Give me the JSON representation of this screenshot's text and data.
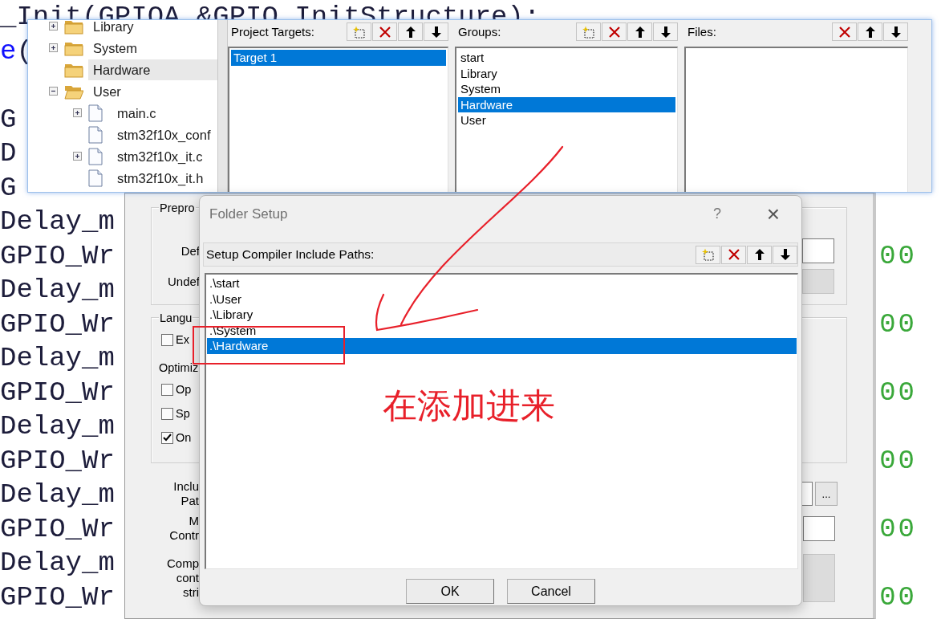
{
  "code_editor": {
    "lines": [
      {
        "kind": "code",
        "text": "_Init(GPIOA,&GPIO_InitStructure);"
      },
      {
        "kind": "call",
        "keyword": "e",
        "text": "("
      },
      {
        "kind": "blank"
      },
      {
        "kind": "code",
        "text": "G"
      },
      {
        "kind": "code",
        "text": "D"
      },
      {
        "kind": "code",
        "text": "G"
      },
      {
        "kind": "code",
        "text": "Delay_m"
      },
      {
        "kind": "code",
        "text": "GPIO_Wr",
        "value": "00"
      },
      {
        "kind": "code",
        "text": "Delay_m"
      },
      {
        "kind": "code",
        "text": "GPIO_Wr",
        "value": "00"
      },
      {
        "kind": "code",
        "text": "Delay_m"
      },
      {
        "kind": "code",
        "text": "GPIO_Wr",
        "value": "00"
      },
      {
        "kind": "code",
        "text": "Delay_m"
      },
      {
        "kind": "code",
        "text": "GPIO_Wr",
        "value": "00"
      },
      {
        "kind": "code",
        "text": "Delay_m"
      },
      {
        "kind": "code",
        "text": "GPIO_Wr",
        "value": "00"
      },
      {
        "kind": "code",
        "text": "Delay_m"
      },
      {
        "kind": "code",
        "text": "GPIO_Wr",
        "value": "00"
      }
    ]
  },
  "options_dialog": {
    "preprocessor_group": {
      "legend": "Prepro",
      "rows": [
        {
          "label": "Def",
          "disabled": false
        },
        {
          "label": "Undef",
          "disabled": true
        }
      ]
    },
    "language_group": {
      "legend": "Langu",
      "checkbox": {
        "label": "Ex",
        "checked": false
      },
      "optimize_label": "Optimiz",
      "checkboxes": [
        {
          "label": "Op",
          "checked": false
        },
        {
          "label": "Sp",
          "checked": false
        },
        {
          "label": "On",
          "checked": true
        }
      ]
    },
    "bottom_rows": [
      {
        "label_lines": [
          "Inclu",
          "Pat"
        ],
        "disabled": false,
        "browse_button": "..."
      },
      {
        "label_lines": [
          "M",
          "Contr"
        ],
        "disabled": false
      },
      {
        "label_lines": [
          "Comp",
          "cont",
          "stri"
        ],
        "disabled": true
      }
    ]
  },
  "project_window": {
    "tree": [
      {
        "kind": "folder",
        "label": "Library",
        "expanded": false,
        "selected": false
      },
      {
        "kind": "folder",
        "label": "System",
        "expanded": false,
        "selected": false
      },
      {
        "kind": "folder",
        "label": "Hardware",
        "selected": true
      },
      {
        "kind": "folder",
        "label": "User",
        "expanded": true,
        "selected": false,
        "children": [
          {
            "kind": "file",
            "label": "main.c",
            "expanded": false,
            "selected": false
          },
          {
            "kind": "file",
            "label": "stm32f10x_conf",
            "selected": false
          },
          {
            "kind": "file",
            "label": "stm32f10x_it.c",
            "expanded": false,
            "selected": false
          },
          {
            "kind": "file",
            "label": "stm32f10x_it.h",
            "selected": false
          }
        ]
      }
    ],
    "panels": [
      {
        "label": "Project Targets:",
        "tools": [
          {
            "kind": "new"
          },
          {
            "kind": "delete"
          },
          {
            "kind": "up"
          },
          {
            "kind": "down"
          }
        ],
        "items": [
          {
            "text": "Target 1",
            "selected": true
          }
        ]
      },
      {
        "label": "Groups:",
        "tools": [
          {
            "kind": "new"
          },
          {
            "kind": "delete"
          },
          {
            "kind": "up"
          },
          {
            "kind": "down"
          }
        ],
        "items": [
          {
            "text": "start",
            "selected": false
          },
          {
            "text": "Library",
            "selected": false
          },
          {
            "text": "System",
            "selected": false
          },
          {
            "text": "Hardware",
            "selected": true
          },
          {
            "text": "User",
            "selected": false
          }
        ]
      },
      {
        "label": "Files:",
        "tools": [
          {
            "kind": "delete"
          },
          {
            "kind": "up"
          },
          {
            "kind": "down"
          }
        ]
      }
    ]
  },
  "folder_setup": {
    "title": "Folder Setup",
    "help": "?",
    "close": "×",
    "list_label": "Setup Compiler Include Paths:",
    "tools": [
      {
        "kind": "new"
      },
      {
        "kind": "delete"
      },
      {
        "kind": "up"
      },
      {
        "kind": "down"
      }
    ],
    "paths": [
      {
        "text": ".\\start",
        "selected": false
      },
      {
        "text": ".\\User",
        "selected": false
      },
      {
        "text": ".\\Library",
        "selected": false
      },
      {
        "text": ".\\System",
        "selected": false
      },
      {
        "text": ".\\Hardware",
        "selected": true
      }
    ],
    "buttons": [
      "OK",
      "Cancel"
    ]
  },
  "annotation": {
    "text": "在添加进来"
  }
}
